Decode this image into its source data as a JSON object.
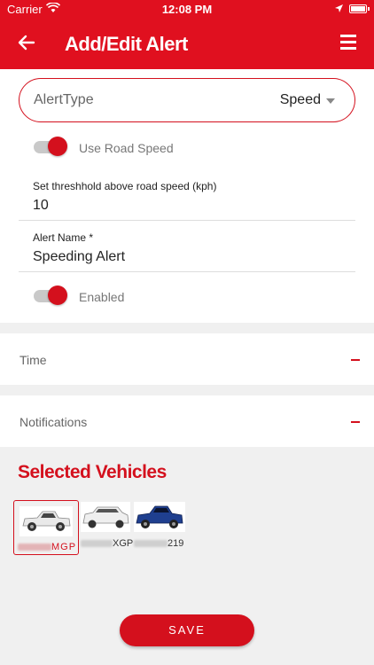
{
  "status_bar": {
    "carrier": "Carrier",
    "time": "12:08 PM"
  },
  "navbar": {
    "title": "Add/Edit Alert"
  },
  "form": {
    "alert_type_label": "AlertType",
    "alert_type_value": "Speed",
    "use_road_speed_label": "Use Road Speed",
    "use_road_speed_on": true,
    "threshold_label": "Set threshhold above road speed (kph)",
    "threshold_value": "10",
    "alert_name_label": "Alert Name *",
    "alert_name_value": "Speeding Alert",
    "enabled_label": "Enabled",
    "enabled_on": true
  },
  "sections": {
    "time_label": "Time",
    "notifications_label": "Notifications"
  },
  "vehicles": {
    "title": "Selected Vehicles",
    "items": [
      {
        "plate_suffix": "MGP",
        "selected": true
      },
      {
        "plate_suffix": "XGP",
        "selected": false
      },
      {
        "plate_suffix": "219",
        "selected": false
      }
    ]
  },
  "save_label": "SAVE",
  "colors": {
    "accent": "#e0101f",
    "toggle_knob": "#d4101d"
  }
}
